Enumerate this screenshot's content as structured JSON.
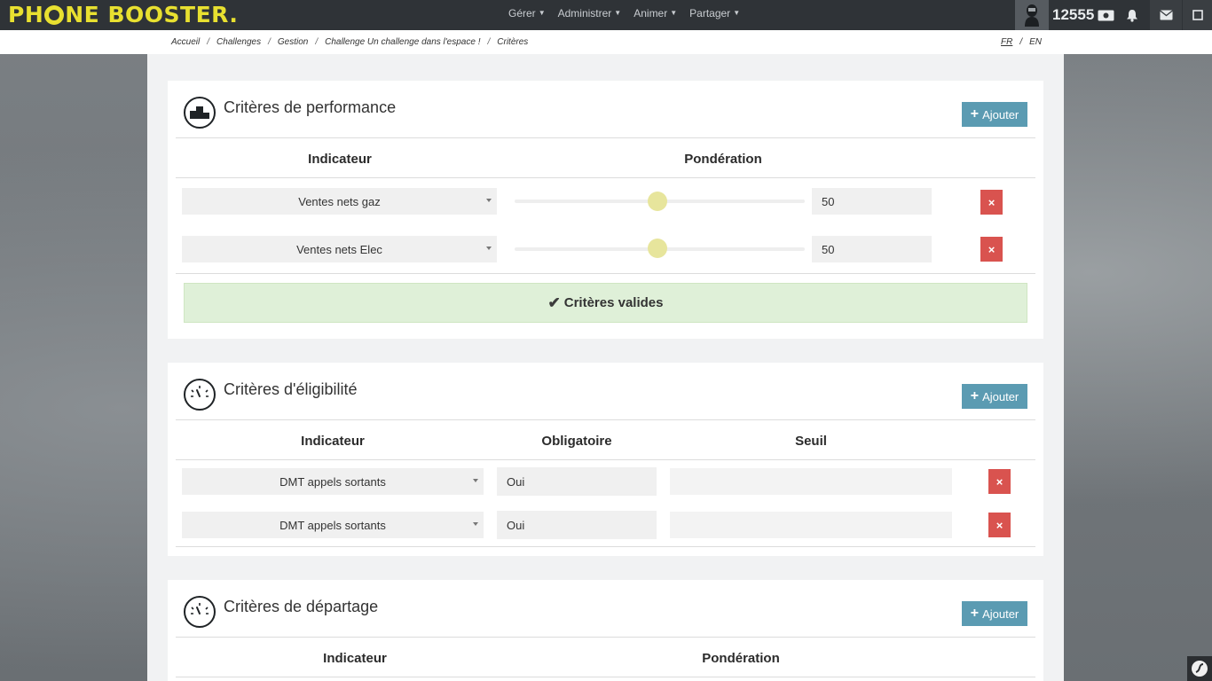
{
  "header": {
    "logo_part1": "PH",
    "logo_part2": "NE BOOSTER.",
    "nav": [
      "Gérer",
      "Administrer",
      "Animer",
      "Partager"
    ],
    "points": "12555",
    "icons": [
      "user-avatar-icon",
      "ticket-icon",
      "bell-icon",
      "envelope-icon",
      "square-icon"
    ]
  },
  "breadcrumb": {
    "items": [
      "Accueil",
      "Challenges",
      "Gestion",
      "Challenge Un challenge dans l'espace !",
      "Critères"
    ],
    "separator": "/"
  },
  "lang": {
    "fr": "FR",
    "sep": "/",
    "en": "EN",
    "active": "FR"
  },
  "add_label": "Ajouter",
  "performance": {
    "title": "Critères de performance",
    "headers": {
      "indicator": "Indicateur",
      "weight": "Pondération"
    },
    "rows": [
      {
        "indicator": "Ventes nets gaz",
        "weight": "50",
        "slider_fraction": 0.5
      },
      {
        "indicator": "Ventes nets Elec",
        "weight": "50",
        "slider_fraction": 0.5
      }
    ],
    "status": "Critères valides"
  },
  "eligibility": {
    "title": "Critères d'éligibilité",
    "headers": {
      "indicator": "Indicateur",
      "mandatory": "Obligatoire",
      "threshold": "Seuil"
    },
    "rows": [
      {
        "indicator": "DMT appels sortants",
        "mandatory": "Oui",
        "threshold": ""
      },
      {
        "indicator": "DMT appels sortants",
        "mandatory": "Oui",
        "threshold": ""
      }
    ]
  },
  "tiebreak": {
    "title": "Critères de départage",
    "headers": {
      "indicator": "Indicateur",
      "weight": "Pondération"
    }
  },
  "colors": {
    "accent": "#5b9bb2",
    "danger": "#d9534f",
    "success_bg": "#dff0d8",
    "logo": "#e8e030",
    "slider": "#e7e59c"
  }
}
